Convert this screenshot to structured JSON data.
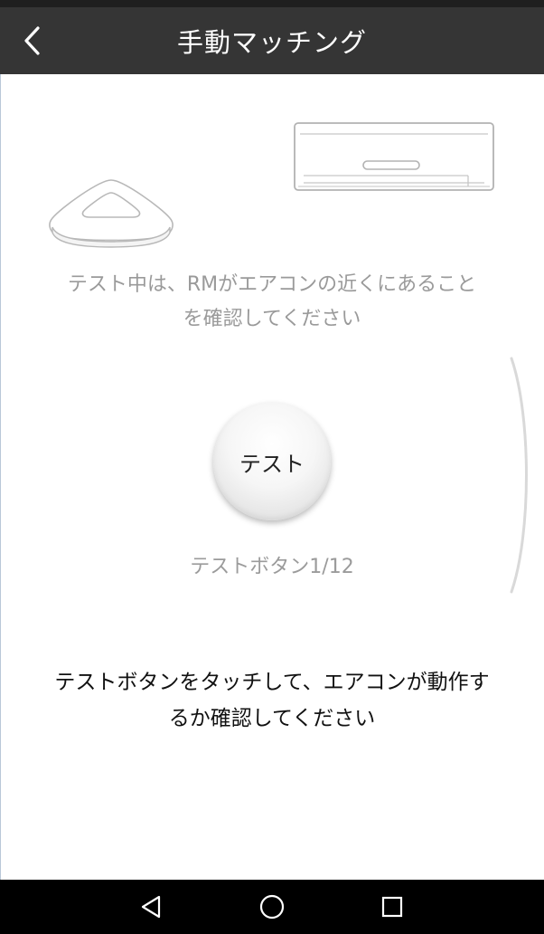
{
  "header": {
    "title": "手動マッチング",
    "back_icon": "chevron-left-icon"
  },
  "illustrations": {
    "hub": "rm-hub-device",
    "air_conditioner": "air-conditioner-unit"
  },
  "hint": {
    "line1": "テスト中は、RMがエアコンの近くにあること",
    "line2": "を確認してください"
  },
  "test_button": {
    "label": "テスト"
  },
  "counter": {
    "text": "テストボタン1/12"
  },
  "instruction": {
    "line1": "テストボタンをタッチして、エアコンが動作す",
    "line2": "るか確認してください"
  },
  "nav_bar": {
    "back": "nav-back-icon",
    "home": "nav-home-icon",
    "recents": "nav-recents-icon"
  },
  "colors": {
    "header_bg": "#353535",
    "hint_text": "#9a9a9a",
    "nav_bg": "#000000"
  }
}
